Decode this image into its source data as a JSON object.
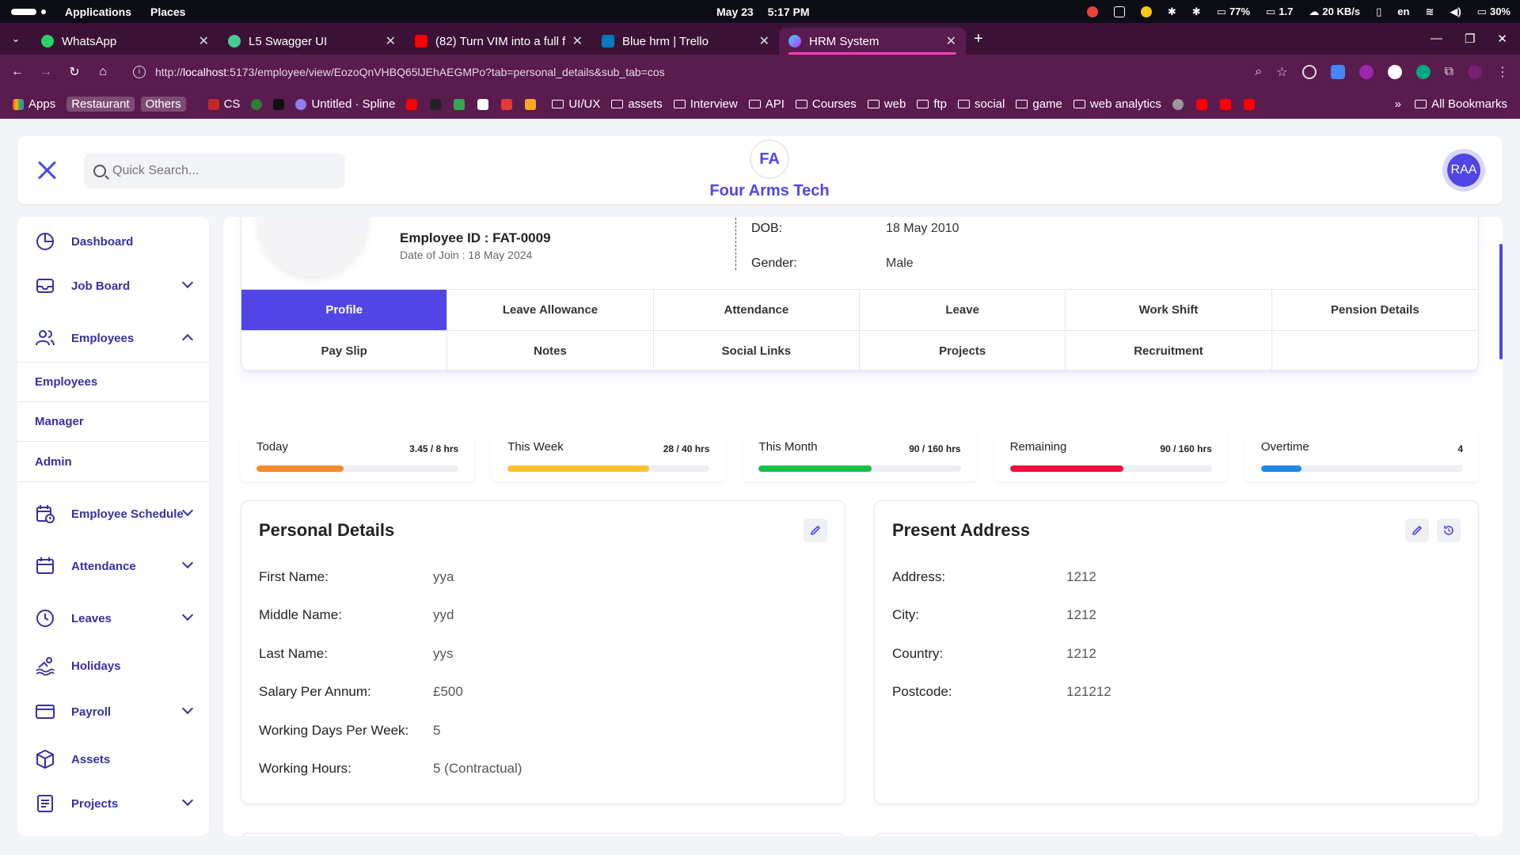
{
  "os": {
    "menu_applications": "Applications",
    "menu_places": "Places",
    "date": "May 23",
    "time": "5:17 PM",
    "battery_bar": "77%",
    "load": "1.7",
    "network": "20 KB/s",
    "lang": "en",
    "battery": "30%"
  },
  "browser": {
    "tabs": [
      {
        "label": "WhatsApp",
        "icon": "whatsapp-icon",
        "color": "#25d366"
      },
      {
        "label": "L5 Swagger UI",
        "icon": "swagger-icon",
        "color": "#49cc90"
      },
      {
        "label": "(82) Turn VIM into a full f…",
        "icon": "youtube-icon",
        "color": "#ff0000"
      },
      {
        "label": "Blue hrm | Trello",
        "icon": "trello-icon",
        "color": "#0079bf"
      },
      {
        "label": "HRM System",
        "icon": "vite-icon",
        "color": "#bd34fe"
      }
    ],
    "url_host": "localhost",
    "url_prefix": "http://",
    "url_rest": ":5173/employee/view/EozoQnVHBQ65lJEhAEGMPo?tab=personal_details&sub_tab=cos",
    "bookmarks": [
      {
        "label": "Apps",
        "kind": "apps"
      },
      {
        "label": "Restaurant",
        "kind": "tag"
      },
      {
        "label": "Others",
        "kind": "tag"
      },
      {
        "label": "CS",
        "kind": "site"
      },
      {
        "label": "Untitled · Spline",
        "kind": "site"
      },
      {
        "label": "UI/UX",
        "kind": "folder"
      },
      {
        "label": "assets",
        "kind": "folder"
      },
      {
        "label": "Interview",
        "kind": "folder"
      },
      {
        "label": "API",
        "kind": "folder"
      },
      {
        "label": "Courses",
        "kind": "folder"
      },
      {
        "label": "web",
        "kind": "folder"
      },
      {
        "label": "ftp",
        "kind": "folder"
      },
      {
        "label": "social",
        "kind": "folder"
      },
      {
        "label": "game",
        "kind": "folder"
      },
      {
        "label": "web analytics",
        "kind": "folder"
      }
    ],
    "all_bookmarks": "All Bookmarks"
  },
  "header": {
    "search_placeholder": "Quick Search...",
    "brand_logo_text": "FA",
    "brand_name": "Four Arms Tech",
    "avatar_initials": "RAA"
  },
  "sidebar": {
    "items": [
      {
        "label": "Dashboard",
        "icon": "pie-chart-icon",
        "expandable": false
      },
      {
        "label": "Job Board",
        "icon": "inbox-icon",
        "expandable": true
      },
      {
        "label": "Employees",
        "icon": "users-icon",
        "expandable": true,
        "expanded": true
      },
      {
        "label": "Employee Schedule",
        "icon": "calendar-clock-icon",
        "expandable": true
      },
      {
        "label": "Attendance",
        "icon": "calendar-icon",
        "expandable": true
      },
      {
        "label": "Leaves",
        "icon": "clock-icon",
        "expandable": true
      },
      {
        "label": "Holidays",
        "icon": "swimmer-icon",
        "expandable": false
      },
      {
        "label": "Payroll",
        "icon": "credit-card-icon",
        "expandable": true
      },
      {
        "label": "Assets",
        "icon": "cube-icon",
        "expandable": false
      },
      {
        "label": "Projects",
        "icon": "document-icon",
        "expandable": true
      }
    ],
    "employee_sub": [
      "Employees",
      "Manager",
      "Admin"
    ]
  },
  "profile": {
    "employee_id": "Employee ID : FAT-0009",
    "date_of_join": "Date of Join : 18 May 2024",
    "dob_label": "DOB:",
    "dob_value": "18 May 2010",
    "gender_label": "Gender:",
    "gender_value": "Male",
    "tabs": [
      "Profile",
      "Leave Allowance",
      "Attendance",
      "Leave",
      "Work Shift",
      "Pension Details",
      "Pay Slip",
      "Notes",
      "Social Links",
      "Projects",
      "Recruitment",
      ""
    ],
    "active_tab": "Profile"
  },
  "stats": [
    {
      "label": "Today",
      "value": "3.45 / 8 hrs",
      "progress": 0.43,
      "color": "#f48c2b"
    },
    {
      "label": "This Week",
      "value": "28 / 40 hrs",
      "progress": 0.7,
      "color": "#fbc02d"
    },
    {
      "label": "This Month",
      "value": "90 / 160 hrs",
      "progress": 0.56,
      "color": "#16c24a"
    },
    {
      "label": "Remaining",
      "value": "90 / 160 hrs",
      "progress": 0.56,
      "color": "#f0103a"
    },
    {
      "label": "Overtime",
      "value": "4",
      "progress": 0.2,
      "color": "#1e88e5"
    }
  ],
  "personal_details": {
    "title": "Personal Details",
    "fields": [
      {
        "label": "First Name:",
        "value": "yya"
      },
      {
        "label": "Middle Name:",
        "value": "yyd"
      },
      {
        "label": "Last Name:",
        "value": "yys"
      },
      {
        "label": "Salary Per Annum:",
        "value": "£500"
      },
      {
        "label": "Working Days Per Week:",
        "value": "5"
      },
      {
        "label": "Working Hours:",
        "value": "5 (Contractual)"
      }
    ]
  },
  "present_address": {
    "title": "Present Address",
    "fields": [
      {
        "label": "Address:",
        "value": "1212"
      },
      {
        "label": "City:",
        "value": "1212"
      },
      {
        "label": "Country:",
        "value": "1212"
      },
      {
        "label": "Postcode:",
        "value": "121212"
      }
    ]
  },
  "colors": {
    "accent": "#4f46e5",
    "sidebar_text": "#3730a3"
  }
}
